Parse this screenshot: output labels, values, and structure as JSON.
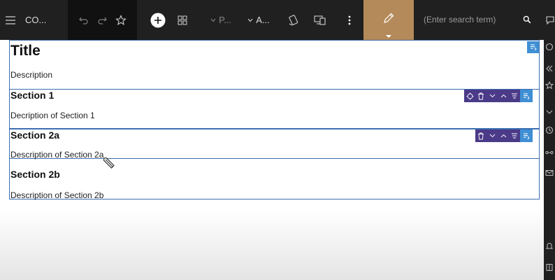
{
  "toolbar": {
    "app_label": "CO...",
    "dropdown_p": "P...",
    "dropdown_a": "A...",
    "search_placeholder": "(Enter search term)"
  },
  "page": {
    "title": "Title",
    "description": "Description",
    "sections": [
      {
        "heading": "Section 1",
        "description": "Decription of Section 1"
      },
      {
        "heading": "Section 2a",
        "description": "Description of Section 2a"
      },
      {
        "heading": "Section 2b",
        "description": "Description of Section 2b"
      }
    ]
  },
  "colors": {
    "toolbar_bg": "#202020",
    "edit_mode_accent": "#b48a5a",
    "selection_border": "#3b6fb0",
    "component_toolbar": "#4a3a88",
    "component_toolbar_active": "#3f8fd4"
  },
  "icons": {
    "toolbar": [
      "menu-icon",
      "undo-icon",
      "redo-icon",
      "star-icon",
      "add-icon",
      "components-icon",
      "chevron-down-icon",
      "chevron-down-icon",
      "rotate-device-icon",
      "responsive-icon",
      "more-vertical-icon",
      "edit-pencil-icon",
      "search-icon",
      "chat-icon"
    ],
    "component": [
      "move-icon",
      "delete-icon",
      "chevron-down-icon",
      "chevron-up-icon",
      "reorder-icon",
      "properties-icon"
    ],
    "sidebar": [
      "circle-icon",
      "double-chevron-left-icon",
      "star-icon",
      "chevron-down-icon",
      "history-icon",
      "share-icon",
      "mail-icon",
      "bell-icon",
      "book-icon"
    ]
  }
}
